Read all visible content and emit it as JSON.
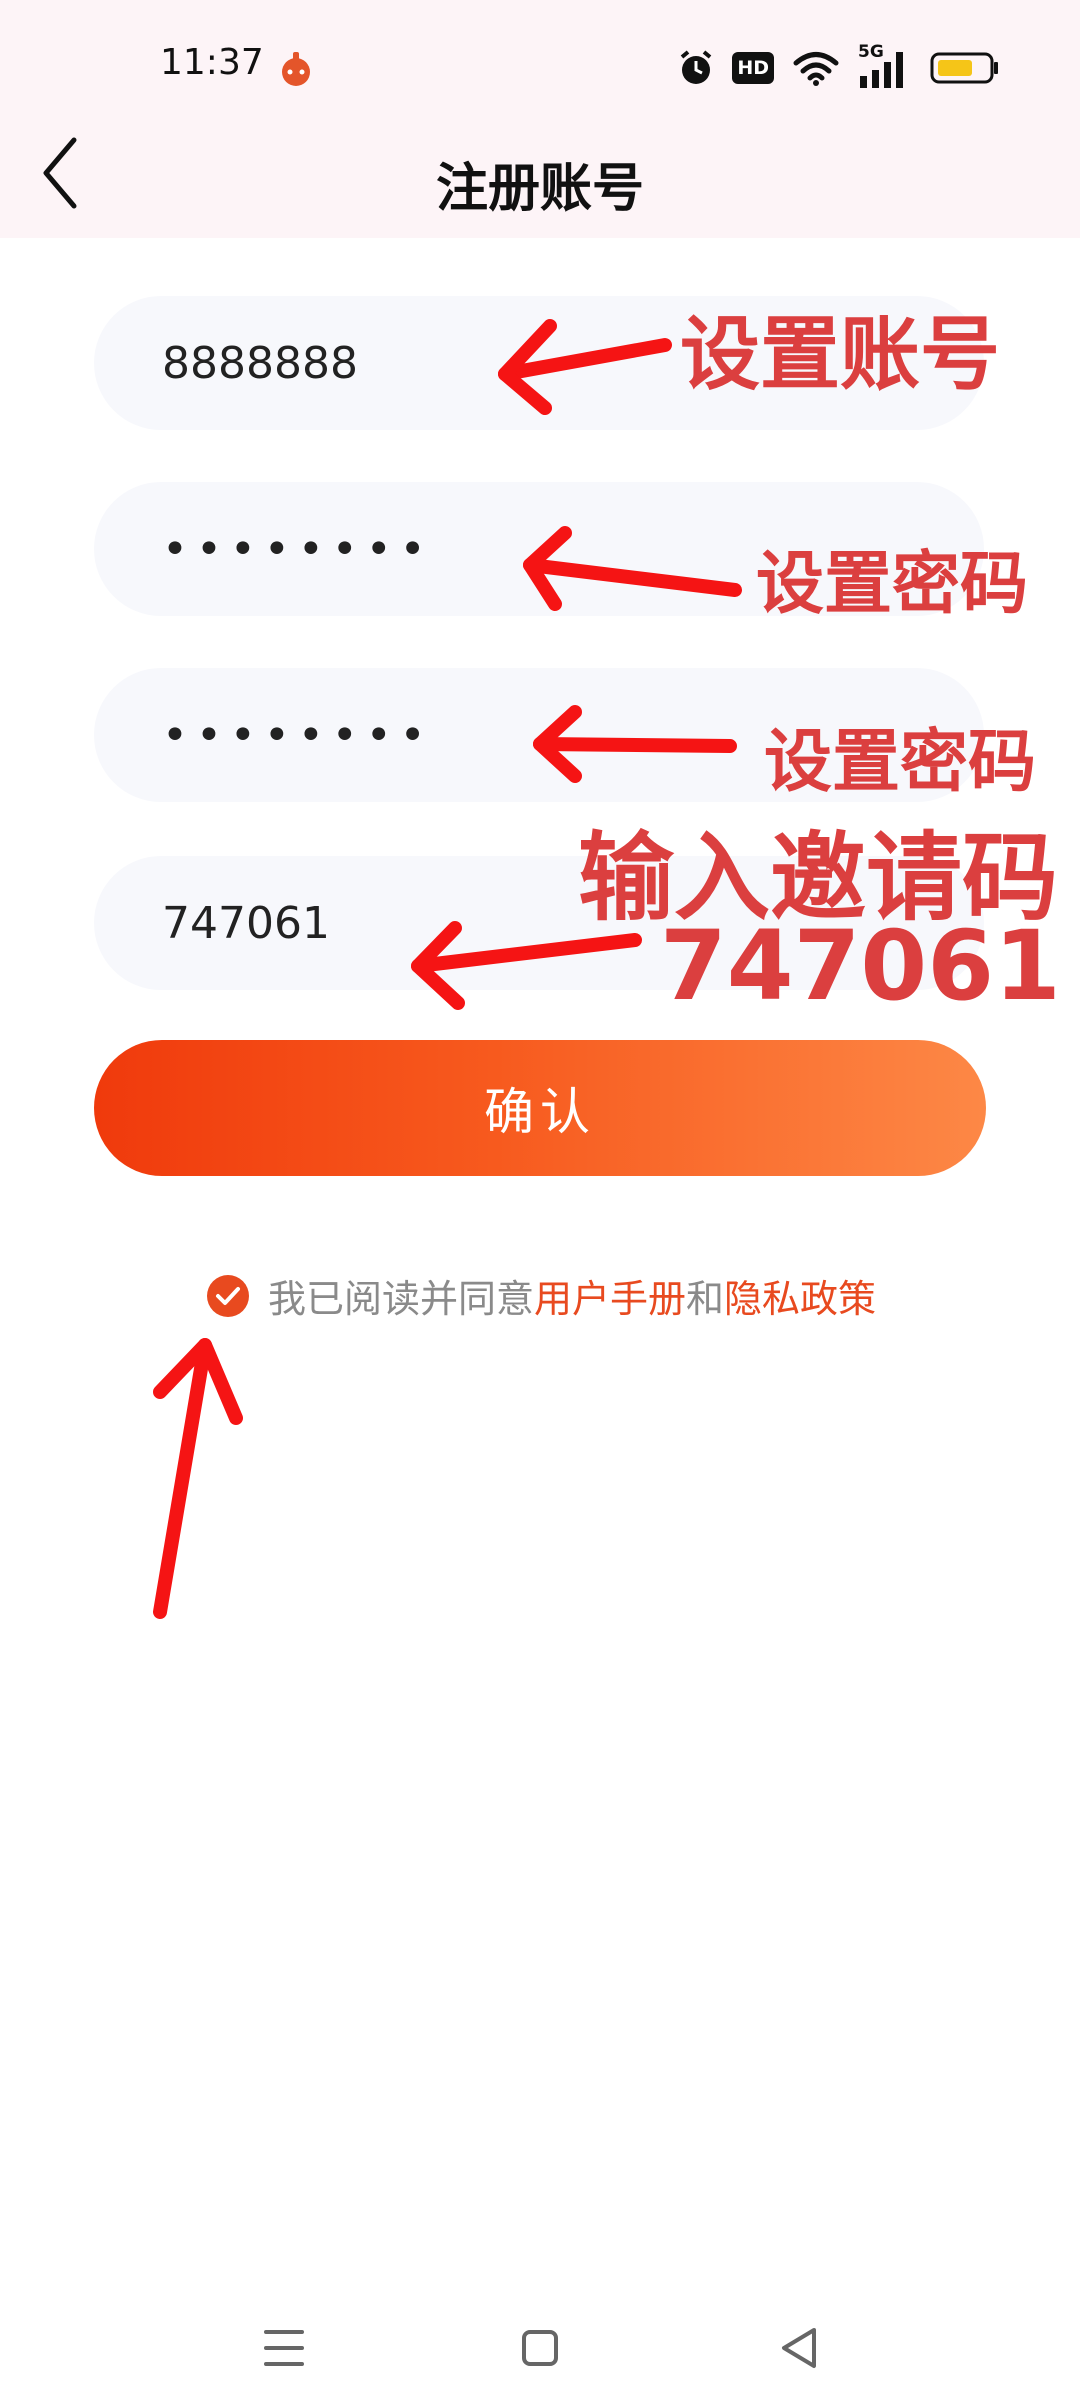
{
  "status_bar": {
    "time": "11:37",
    "icons": [
      "app-notification-icon",
      "alarm-icon",
      "hd-icon",
      "wifi-icon",
      "5g-signal-icon",
      "battery-icon"
    ],
    "hd_label": "HD",
    "network_label": "5G",
    "battery_color": "#f5c518"
  },
  "header": {
    "title": "注册账号",
    "back_icon": "chevron-left-icon"
  },
  "form": {
    "account_value": "8888888",
    "password_value": "••••••••",
    "confirm_password_value": "••••••••",
    "invite_code_value": "747061",
    "submit_label": "确认"
  },
  "agreement": {
    "checked": true,
    "prefix": "我已阅读并同意",
    "user_manual_link": "用户手册",
    "and": "和",
    "privacy_link": "隐私政策"
  },
  "annotations": {
    "account": "设置账号",
    "password": "设置密码",
    "confirm_password": "设置密码",
    "invite_line1": "输入邀请码",
    "invite_line2": "747061",
    "color": "#db3f3f"
  },
  "nav_bar": {
    "icons": [
      "menu-icon",
      "home-icon",
      "back-triangle-icon"
    ]
  },
  "colors": {
    "accent": "#f03a0c",
    "accent_end": "#fd8846",
    "link": "#e84a1f",
    "header_bg": "#fdf4f7",
    "field_bg": "#f7f8fc"
  }
}
